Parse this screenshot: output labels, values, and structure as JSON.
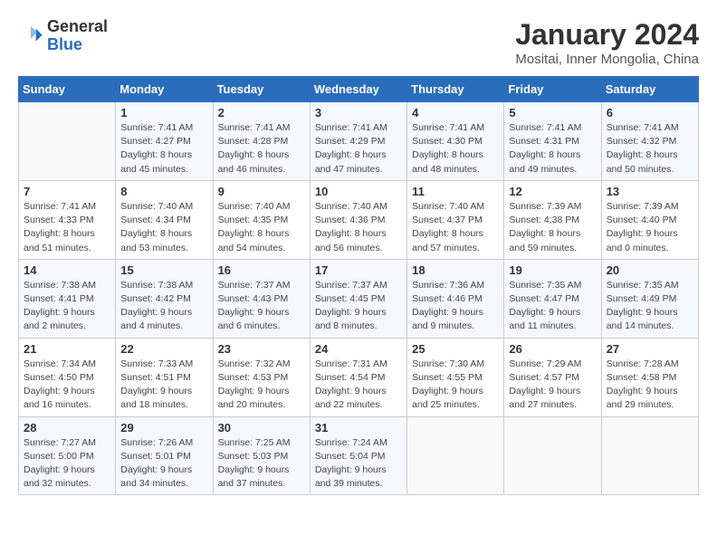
{
  "logo": {
    "general": "General",
    "blue": "Blue"
  },
  "title": "January 2024",
  "subtitle": "Mositai, Inner Mongolia, China",
  "days_header": [
    "Sunday",
    "Monday",
    "Tuesday",
    "Wednesday",
    "Thursday",
    "Friday",
    "Saturday"
  ],
  "weeks": [
    [
      {
        "day": "",
        "info": ""
      },
      {
        "day": "1",
        "info": "Sunrise: 7:41 AM\nSunset: 4:27 PM\nDaylight: 8 hours\nand 45 minutes."
      },
      {
        "day": "2",
        "info": "Sunrise: 7:41 AM\nSunset: 4:28 PM\nDaylight: 8 hours\nand 46 minutes."
      },
      {
        "day": "3",
        "info": "Sunrise: 7:41 AM\nSunset: 4:29 PM\nDaylight: 8 hours\nand 47 minutes."
      },
      {
        "day": "4",
        "info": "Sunrise: 7:41 AM\nSunset: 4:30 PM\nDaylight: 8 hours\nand 48 minutes."
      },
      {
        "day": "5",
        "info": "Sunrise: 7:41 AM\nSunset: 4:31 PM\nDaylight: 8 hours\nand 49 minutes."
      },
      {
        "day": "6",
        "info": "Sunrise: 7:41 AM\nSunset: 4:32 PM\nDaylight: 8 hours\nand 50 minutes."
      }
    ],
    [
      {
        "day": "7",
        "info": "Sunrise: 7:41 AM\nSunset: 4:33 PM\nDaylight: 8 hours\nand 51 minutes."
      },
      {
        "day": "8",
        "info": "Sunrise: 7:40 AM\nSunset: 4:34 PM\nDaylight: 8 hours\nand 53 minutes."
      },
      {
        "day": "9",
        "info": "Sunrise: 7:40 AM\nSunset: 4:35 PM\nDaylight: 8 hours\nand 54 minutes."
      },
      {
        "day": "10",
        "info": "Sunrise: 7:40 AM\nSunset: 4:36 PM\nDaylight: 8 hours\nand 56 minutes."
      },
      {
        "day": "11",
        "info": "Sunrise: 7:40 AM\nSunset: 4:37 PM\nDaylight: 8 hours\nand 57 minutes."
      },
      {
        "day": "12",
        "info": "Sunrise: 7:39 AM\nSunset: 4:38 PM\nDaylight: 8 hours\nand 59 minutes."
      },
      {
        "day": "13",
        "info": "Sunrise: 7:39 AM\nSunset: 4:40 PM\nDaylight: 9 hours\nand 0 minutes."
      }
    ],
    [
      {
        "day": "14",
        "info": "Sunrise: 7:38 AM\nSunset: 4:41 PM\nDaylight: 9 hours\nand 2 minutes."
      },
      {
        "day": "15",
        "info": "Sunrise: 7:38 AM\nSunset: 4:42 PM\nDaylight: 9 hours\nand 4 minutes."
      },
      {
        "day": "16",
        "info": "Sunrise: 7:37 AM\nSunset: 4:43 PM\nDaylight: 9 hours\nand 6 minutes."
      },
      {
        "day": "17",
        "info": "Sunrise: 7:37 AM\nSunset: 4:45 PM\nDaylight: 9 hours\nand 8 minutes."
      },
      {
        "day": "18",
        "info": "Sunrise: 7:36 AM\nSunset: 4:46 PM\nDaylight: 9 hours\nand 9 minutes."
      },
      {
        "day": "19",
        "info": "Sunrise: 7:35 AM\nSunset: 4:47 PM\nDaylight: 9 hours\nand 11 minutes."
      },
      {
        "day": "20",
        "info": "Sunrise: 7:35 AM\nSunset: 4:49 PM\nDaylight: 9 hours\nand 14 minutes."
      }
    ],
    [
      {
        "day": "21",
        "info": "Sunrise: 7:34 AM\nSunset: 4:50 PM\nDaylight: 9 hours\nand 16 minutes."
      },
      {
        "day": "22",
        "info": "Sunrise: 7:33 AM\nSunset: 4:51 PM\nDaylight: 9 hours\nand 18 minutes."
      },
      {
        "day": "23",
        "info": "Sunrise: 7:32 AM\nSunset: 4:53 PM\nDaylight: 9 hours\nand 20 minutes."
      },
      {
        "day": "24",
        "info": "Sunrise: 7:31 AM\nSunset: 4:54 PM\nDaylight: 9 hours\nand 22 minutes."
      },
      {
        "day": "25",
        "info": "Sunrise: 7:30 AM\nSunset: 4:55 PM\nDaylight: 9 hours\nand 25 minutes."
      },
      {
        "day": "26",
        "info": "Sunrise: 7:29 AM\nSunset: 4:57 PM\nDaylight: 9 hours\nand 27 minutes."
      },
      {
        "day": "27",
        "info": "Sunrise: 7:28 AM\nSunset: 4:58 PM\nDaylight: 9 hours\nand 29 minutes."
      }
    ],
    [
      {
        "day": "28",
        "info": "Sunrise: 7:27 AM\nSunset: 5:00 PM\nDaylight: 9 hours\nand 32 minutes."
      },
      {
        "day": "29",
        "info": "Sunrise: 7:26 AM\nSunset: 5:01 PM\nDaylight: 9 hours\nand 34 minutes."
      },
      {
        "day": "30",
        "info": "Sunrise: 7:25 AM\nSunset: 5:03 PM\nDaylight: 9 hours\nand 37 minutes."
      },
      {
        "day": "31",
        "info": "Sunrise: 7:24 AM\nSunset: 5:04 PM\nDaylight: 9 hours\nand 39 minutes."
      },
      {
        "day": "",
        "info": ""
      },
      {
        "day": "",
        "info": ""
      },
      {
        "day": "",
        "info": ""
      }
    ]
  ]
}
